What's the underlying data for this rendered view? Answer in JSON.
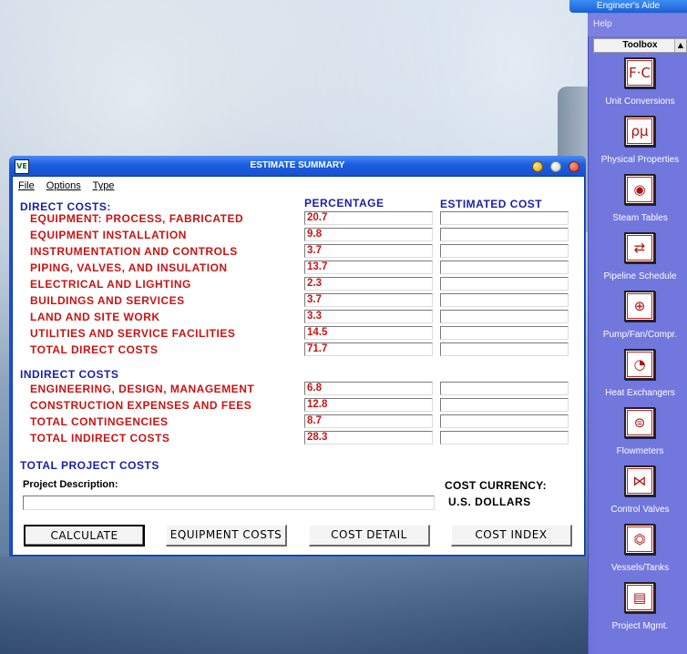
{
  "toolbox": {
    "app_title": "Engineer's Aide",
    "help": "Help",
    "header": "Toolbox",
    "items": [
      {
        "label": "Unit Conversions",
        "icon": "unit-conversions-icon",
        "glyph": "F·C"
      },
      {
        "label": "Physical Properties",
        "icon": "physical-properties-icon",
        "glyph": "ρμ"
      },
      {
        "label": "Steam Tables",
        "icon": "steam-tables-icon",
        "glyph": "◉"
      },
      {
        "label": "Pipeline Schedule",
        "icon": "pipeline-schedule-icon",
        "glyph": "⇄"
      },
      {
        "label": "Pump/Fan/Compr.",
        "icon": "pump-fan-compressor-icon",
        "glyph": "⊕"
      },
      {
        "label": "Heat Exchangers",
        "icon": "heat-exchangers-icon",
        "glyph": "◔"
      },
      {
        "label": "Flowmeters",
        "icon": "flowmeters-icon",
        "glyph": "⊜"
      },
      {
        "label": "Control Valves",
        "icon": "control-valves-icon",
        "glyph": "⋈"
      },
      {
        "label": "Vessels/Tanks",
        "icon": "vessels-tanks-icon",
        "glyph": "⏣"
      },
      {
        "label": "Project Mgmt.",
        "icon": "project-management-icon",
        "glyph": "▤"
      }
    ]
  },
  "window": {
    "title": "ESTIMATE SUMMARY",
    "menu": [
      "File",
      "Options",
      "Type"
    ],
    "headers": {
      "percentage": "PERCENTAGE",
      "estimated_cost": "ESTIMATED COST"
    },
    "direct": {
      "heading": "DIRECT COSTS:",
      "rows": [
        {
          "label": "EQUIPMENT: PROCESS,  FABRICATED",
          "pct": "20.7",
          "cost": ""
        },
        {
          "label": "EQUIPMENT INSTALLATION",
          "pct": "9.8",
          "cost": ""
        },
        {
          "label": "INSTRUMENTATION AND CONTROLS",
          "pct": "3.7",
          "cost": ""
        },
        {
          "label": "PIPING, VALVES, AND INSULATION",
          "pct": "13.7",
          "cost": ""
        },
        {
          "label": "ELECTRICAL AND LIGHTING",
          "pct": "2.3",
          "cost": ""
        },
        {
          "label": "BUILDINGS AND SERVICES",
          "pct": "3.7",
          "cost": ""
        },
        {
          "label": "LAND AND SITE WORK",
          "pct": "3.3",
          "cost": ""
        },
        {
          "label": "UTILITIES AND SERVICE FACILITIES",
          "pct": "14.5",
          "cost": ""
        },
        {
          "label": "TOTAL DIRECT COSTS",
          "pct": "71.7",
          "cost": ""
        }
      ]
    },
    "indirect": {
      "heading": "INDIRECT COSTS",
      "rows": [
        {
          "label": "ENGINEERING, DESIGN, MANAGEMENT",
          "pct": "6.8",
          "cost": ""
        },
        {
          "label": "CONSTRUCTION EXPENSES AND FEES",
          "pct": "12.8",
          "cost": ""
        },
        {
          "label": "TOTAL CONTINGENCIES",
          "pct": "8.7",
          "cost": ""
        },
        {
          "label": "TOTAL INDIRECT COSTS",
          "pct": "28.3",
          "cost": ""
        }
      ]
    },
    "total_project": "TOTAL PROJECT COSTS",
    "project_description_label": "Project Description:",
    "project_description_value": "",
    "currency_label": "COST CURRENCY:",
    "currency_value": "U.S. DOLLARS",
    "buttons": {
      "calculate": "CALCULATE",
      "equipment_costs": "EQUIPMENT COSTS",
      "cost_detail": "COST DETAIL",
      "cost_index": "COST INDEX"
    }
  },
  "colors": {
    "label_red": "#c81414",
    "heading_blue": "#1a1fa8",
    "toolbox_bg": "#6e74d9"
  }
}
